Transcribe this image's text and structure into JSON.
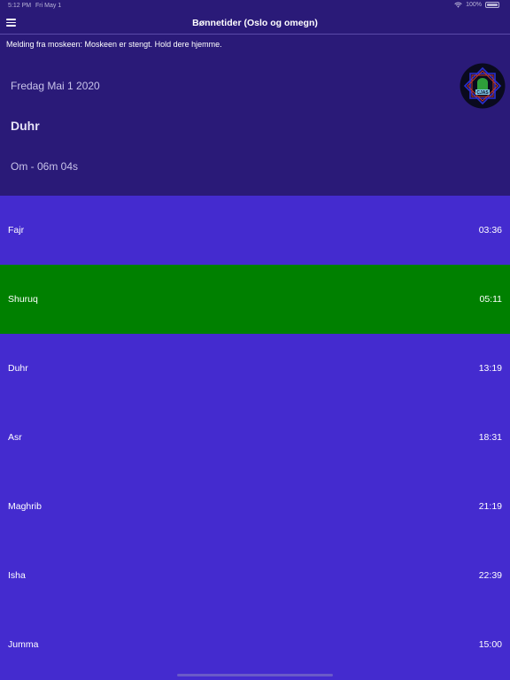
{
  "status_bar": {
    "time": "5:12 PM",
    "date": "Fri May 1",
    "battery": "100%"
  },
  "nav": {
    "title": "Bønnetider (Oslo og omegn)"
  },
  "message": "Melding fra moskeen: Moskeen er stengt. Hold dere hjemme.",
  "header": {
    "date": "Fredag Mai 1 2020",
    "next_prayer": "Duhr",
    "countdown": "Om -  06m 04s",
    "logo_text": "CJAS"
  },
  "prayers": [
    {
      "name": "Fajr",
      "time": "03:36",
      "active": false
    },
    {
      "name": "Shuruq",
      "time": "05:11",
      "active": true
    },
    {
      "name": "Duhr",
      "time": "13:19",
      "active": false
    },
    {
      "name": "Asr",
      "time": "18:31",
      "active": false
    },
    {
      "name": "Maghrib",
      "time": "21:19",
      "active": false
    },
    {
      "name": "Isha",
      "time": "22:39",
      "active": false
    },
    {
      "name": "Jumma",
      "time": "15:00",
      "active": false
    }
  ],
  "colors": {
    "bar": "#2a1a78",
    "list": "#442bcf",
    "active": "#008000"
  }
}
